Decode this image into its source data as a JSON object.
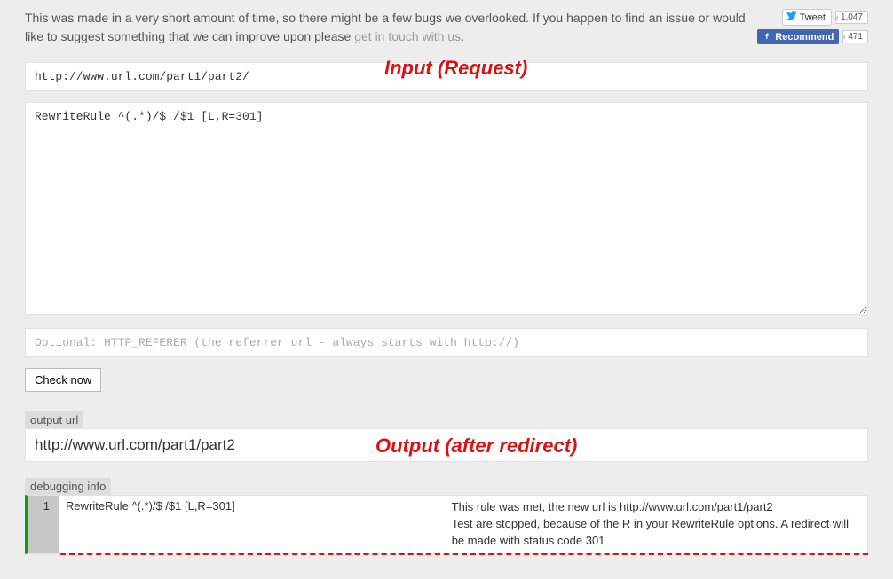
{
  "intro": {
    "text_before": "This was made in a very short amount of time, so there might be a few bugs we overlooked. If you happen to find an issue or would like to suggest something that we can improve upon please ",
    "link_text": "get in touch with us",
    "text_after": "."
  },
  "social": {
    "tweet_label": "Tweet",
    "tweet_count": "1,047",
    "recommend_label": "Recommend",
    "recommend_count": "471"
  },
  "form": {
    "url_value": "http://www.url.com/part1/part2/",
    "rules_value": "RewriteRule ^(.*)/$ /$1 [L,R=301]",
    "referer_placeholder": "Optional: HTTP_REFERER (the referrer url - always starts with http://)",
    "check_button": "Check now"
  },
  "output": {
    "label": "output url",
    "value": "http://www.url.com/part1/part2"
  },
  "debug": {
    "label": "debugging info",
    "line_num": "1",
    "rule": "RewriteRule ^(.*)/$ /$1 [L,R=301]",
    "explain": "This rule was met, the new url is http://www.url.com/part1/part2\nTest are stopped, because of the R in your RewriteRule options. A redirect will be made with status code 301"
  },
  "annotations": {
    "input_label": "Input    (Request)",
    "output_label": "Output (after redirect)"
  }
}
